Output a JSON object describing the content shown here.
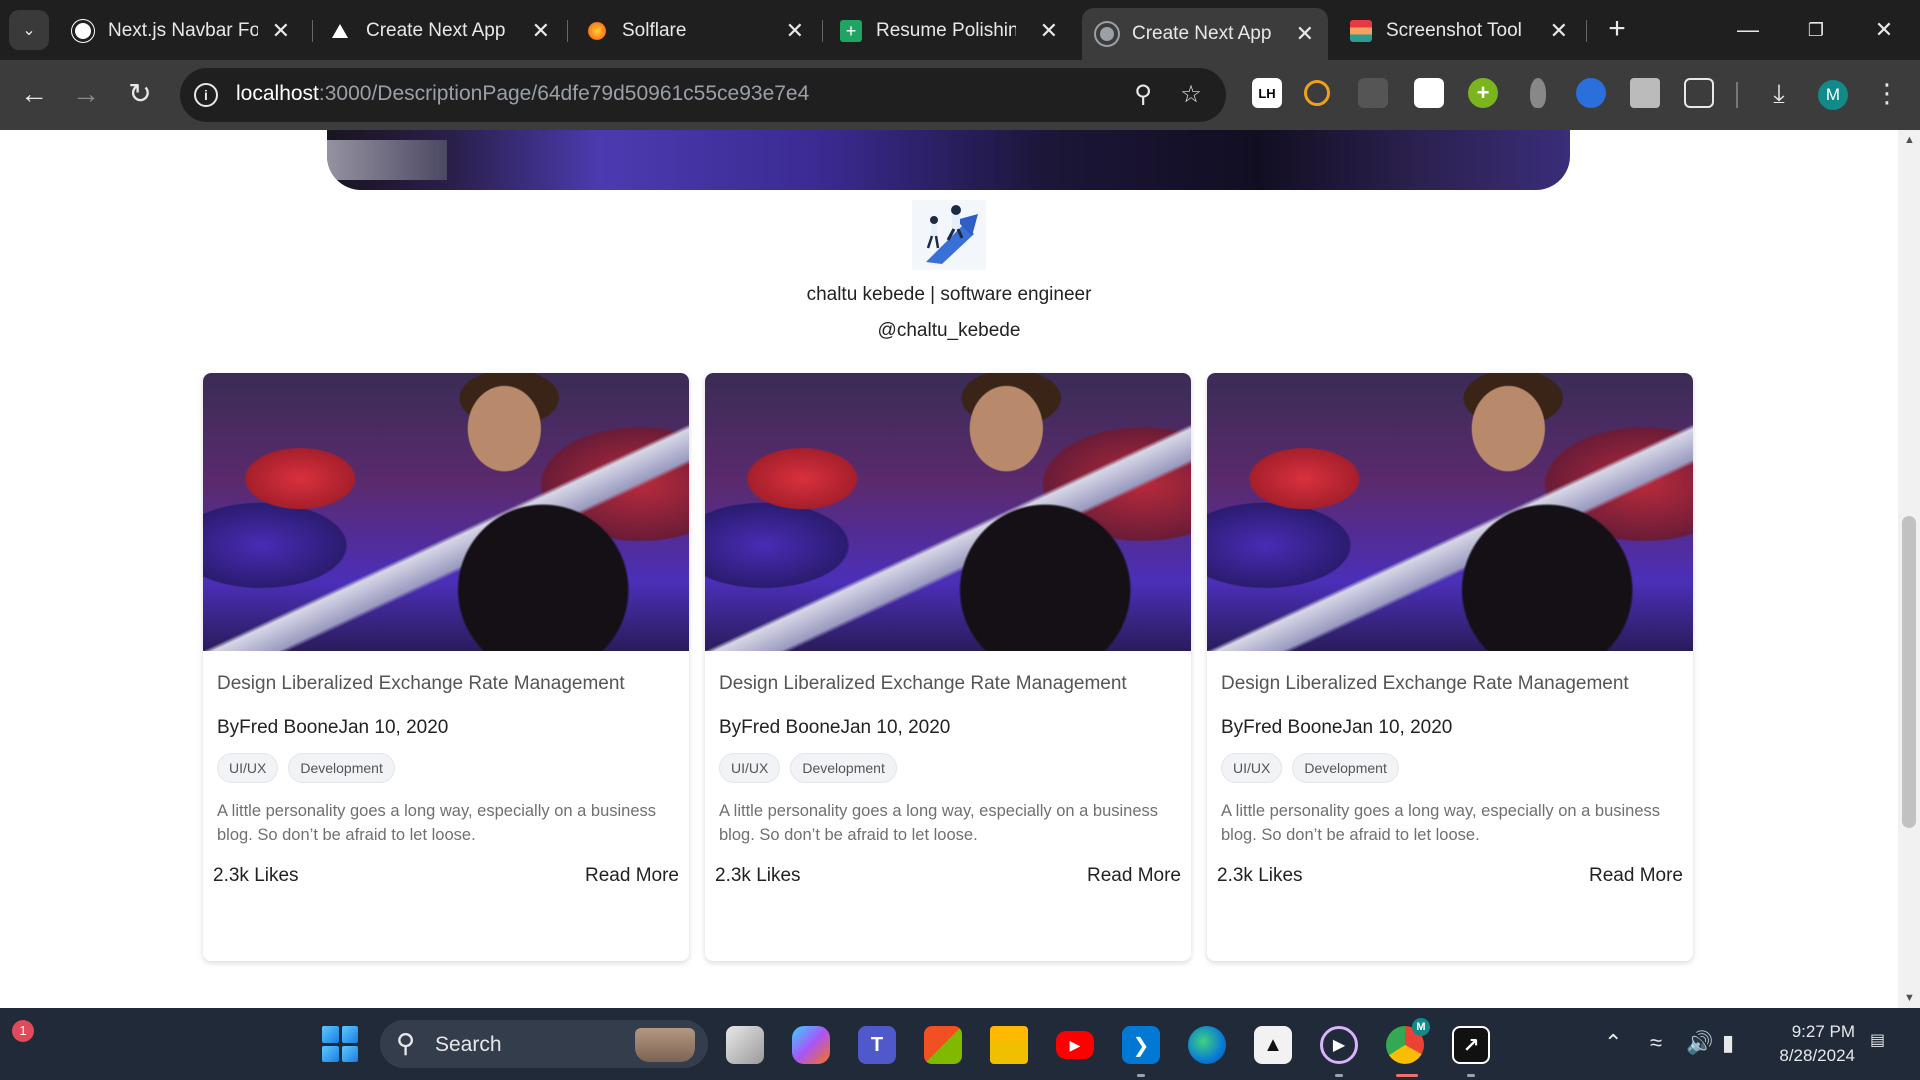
{
  "browser": {
    "tabs": [
      {
        "title": "Next.js Navbar Foo",
        "icon": "chatgpt-icon",
        "active": false
      },
      {
        "title": "Create Next App",
        "icon": "vercel-triangle-icon",
        "active": false
      },
      {
        "title": "Solflare",
        "icon": "solflare-icon",
        "active": false
      },
      {
        "title": "Resume Polishing T",
        "icon": "sheets-plus-icon",
        "active": false
      },
      {
        "title": "Create Next App",
        "icon": "globe-icon",
        "active": true
      },
      {
        "title": "Screenshot Tool - S",
        "icon": "screenshot-tool-icon",
        "active": false
      }
    ],
    "url_host": "localhost",
    "url_path": ":3000/DescriptionPage/64dfe79d50961c55ce93e7e4",
    "profile_initial": "M",
    "extension_lh_label": "LH"
  },
  "author": {
    "name": "chaltu kebede | software engineer",
    "handle": "@chaltu_kebede"
  },
  "cards": [
    {
      "title": "Design Liberalized Exchange Rate Management",
      "author_date": "ByFred BooneJan 10, 2020",
      "tags": [
        "UI/UX",
        "Development"
      ],
      "description": "A little personality goes a long way, especially on a business blog. So don’t be afraid to let loose.",
      "likes": "2.3k Likes",
      "read_more": "Read More"
    },
    {
      "title": "Design Liberalized Exchange Rate Management",
      "author_date": "ByFred BooneJan 10, 2020",
      "tags": [
        "UI/UX",
        "Development"
      ],
      "description": "A little personality goes a long way, especially on a business blog. So don’t be afraid to let loose.",
      "likes": "2.3k Likes",
      "read_more": "Read More"
    },
    {
      "title": "Design Liberalized Exchange Rate Management",
      "author_date": "ByFred BooneJan 10, 2020",
      "tags": [
        "UI/UX",
        "Development"
      ],
      "description": "A little personality goes a long way, especially on a business blog. So don’t be afraid to let loose.",
      "likes": "2.3k Likes",
      "read_more": "Read More"
    }
  ],
  "taskbar": {
    "notification_count": "1",
    "search_label": "Search",
    "time": "9:27 PM",
    "date": "8/28/2024",
    "chrome_badge": "M"
  },
  "colors": {
    "tabbar_bg": "#1f1f1f",
    "toolbar_bg": "#3c3c3c",
    "taskbar_bg": "#202a38"
  }
}
